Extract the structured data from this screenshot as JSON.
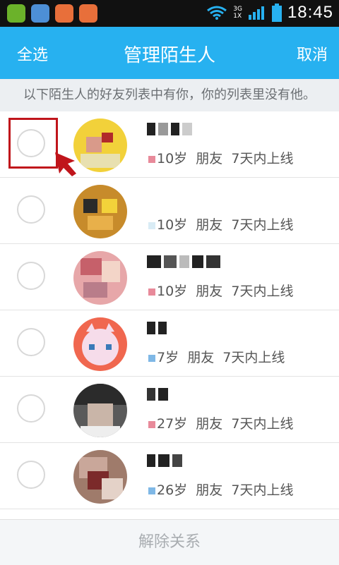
{
  "status": {
    "network": "3G",
    "network_sub": "1X",
    "time": "18:45",
    "icon_colors": [
      "#6bb22a",
      "#4d8fd6",
      "#e86f3a",
      "#e86f3a"
    ]
  },
  "titlebar": {
    "left_action": "全选",
    "title": "管理陌生人",
    "right_action": "取消",
    "bg_color": "#27b1f0"
  },
  "hint": "以下陌生人的好友列表中有你，你的列表里没有他。",
  "rows": [
    {
      "age": "10岁",
      "relation": "朋友",
      "online": "7天内上线",
      "avatar_color": "#f2d13a"
    },
    {
      "age": "10岁",
      "relation": "朋友",
      "online": "7天内上线",
      "avatar_color": "#c78b2b"
    },
    {
      "age": "10岁",
      "relation": "朋友",
      "online": "7天内上线",
      "avatar_color": "#e7a7a9"
    },
    {
      "age": "7岁",
      "relation": "朋友",
      "online": "7天内上线",
      "avatar_color": "#f0674f"
    },
    {
      "age": "27岁",
      "relation": "朋友",
      "online": "7天内上线",
      "avatar_color": "#5a5a5a"
    },
    {
      "age": "26岁",
      "relation": "朋友",
      "online": "7天内上线",
      "avatar_color": "#9f7b6b"
    }
  ],
  "bottom": {
    "button_label": "解除关系"
  },
  "colors": {
    "female_dot": "#e88a9a",
    "male_dot": "#7fb8e6",
    "highlight": "#c0151b"
  }
}
